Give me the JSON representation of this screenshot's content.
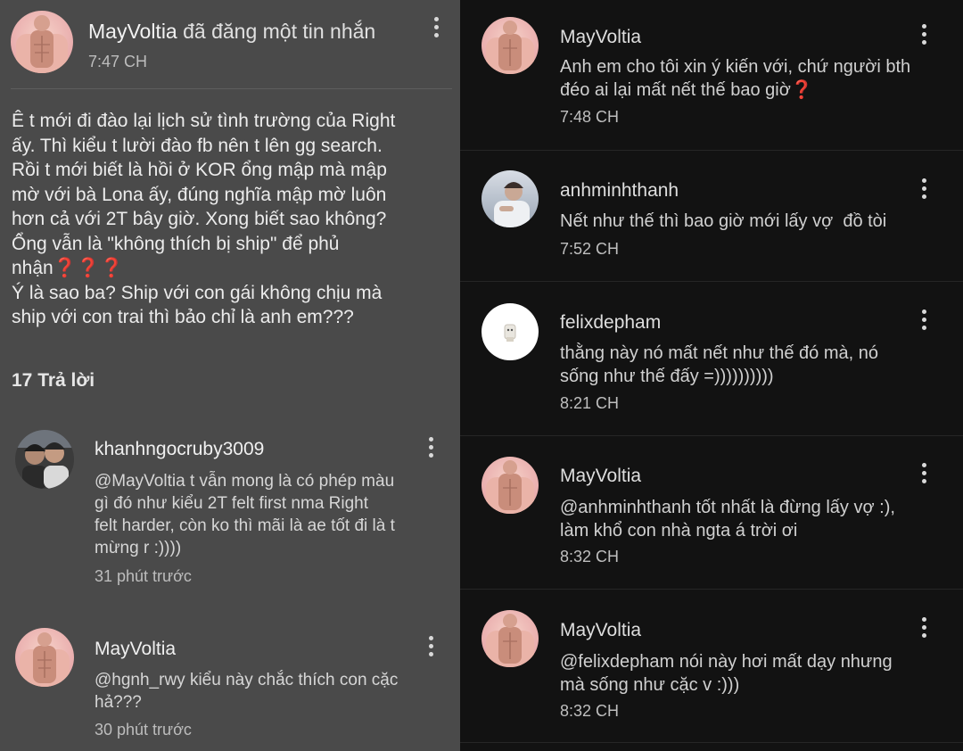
{
  "main_post": {
    "author": "MayVoltia",
    "action": " đã đăng một tin nhắn",
    "time": "7:47 CH",
    "body": "Ê t mới đi đào lại lịch sử tình trường của Right\nấy. Thì kiểu t lười đào fb nên t lên gg search.\nRồi t mới biết là hồi ở KOR ổng mập mà mập\nmờ với bà Lona ấy, đúng nghĩa mập mờ luôn\nhơn cả với 2T bây giờ. Xong biết sao không?\nỔng vẫn là \"không thích bị ship\" để phủ\nnhận",
    "body_emoji": "❓❓❓",
    "body_tail": "Ý là sao ba? Ship với con gái không chịu mà\nship với con trai thì bảo chỉ là anh em???"
  },
  "reply_count": "17 Trả lời",
  "replies": [
    {
      "name": "khanhngocruby3009",
      "text": "@MayVoltia t vẫn mong là có phép màu\ngì đó như kiểu 2T felt first nma Right\nfelt harder, còn ko thì mãi là ae tốt đi là t\nmừng r :))))",
      "time": "31 phút trước"
    },
    {
      "name": "MayVoltia",
      "text": "@hgnh_rwy kiểu này chắc thích con cặc\nhả???",
      "time": "30 phút trước"
    }
  ],
  "thread": [
    {
      "name": "MayVoltia",
      "text": "Anh em cho tôi xin ý kiến với, chứ người bth\nđéo ai lại mất nết thế bao giờ",
      "emoji": "❓",
      "time": "7:48 CH"
    },
    {
      "name": "anhminhthanh",
      "text": "Nết như thế thì bao giờ mới lấy vợ  đồ tòi",
      "emoji": "",
      "time": "7:52 CH"
    },
    {
      "name": "felixdepham",
      "text": "thằng này nó mất nết như thế đó mà, nó\nsống như thế đấy =))))))))))",
      "emoji": "",
      "time": "8:21 CH"
    },
    {
      "name": "MayVoltia",
      "text": "@anhminhthanh tốt nhất là đừng lấy vợ :),\nlàm khổ con nhà ngta á trời ơi",
      "emoji": "",
      "time": "8:32 CH"
    },
    {
      "name": "MayVoltia",
      "text": "@felixdepham nói này hơi mất dạy nhưng\nmà sống như cặc v :)))",
      "emoji": "",
      "time": "8:32 CH"
    }
  ],
  "colors": {
    "left_bg": "#4a4a4a",
    "right_bg": "#121212",
    "emoji_red": "#e53935"
  }
}
